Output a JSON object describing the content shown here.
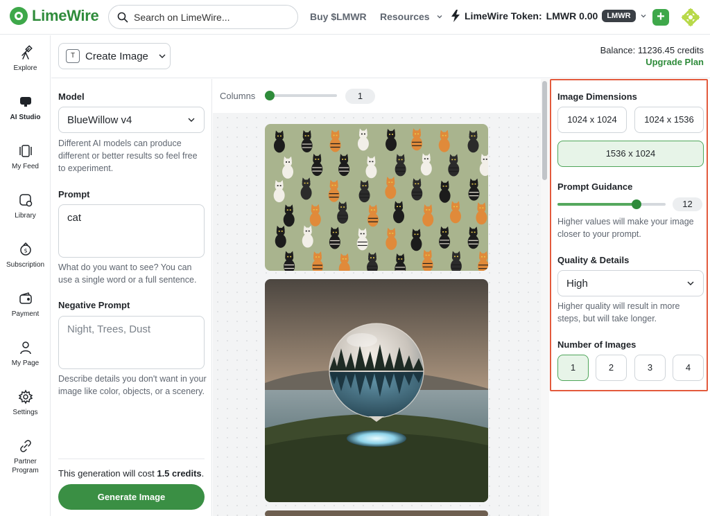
{
  "header": {
    "logo_text": "LimeWire",
    "search_placeholder": "Search on LimeWire...",
    "buy_label": "Buy $LMWR",
    "resources_label": "Resources",
    "token_label": "LimeWire Token:",
    "token_value": "LMWR 0.00",
    "token_badge": "LMWR",
    "plus_icon": "plus-icon",
    "avatar_icon": "avatar-icon"
  },
  "sidebar": {
    "items": [
      {
        "label": "Explore",
        "icon": "telescope-icon"
      },
      {
        "label": "AI Studio",
        "icon": "monitor-icon"
      },
      {
        "label": "My Feed",
        "icon": "feed-icon"
      },
      {
        "label": "Library",
        "icon": "library-icon"
      },
      {
        "label": "Subscription",
        "icon": "subscription-icon"
      },
      {
        "label": "Payment",
        "icon": "wallet-icon"
      },
      {
        "label": "My Page",
        "icon": "user-icon"
      },
      {
        "label": "Settings",
        "icon": "gear-icon"
      },
      {
        "label_line1": "Partner",
        "label_line2": "Program",
        "icon": "link-icon"
      }
    ]
  },
  "topbar": {
    "create_label": "Create Image",
    "balance": "Balance: 11236.45 credits",
    "upgrade": "Upgrade Plan"
  },
  "left": {
    "model_label": "Model",
    "model_value": "BlueWillow v4",
    "model_help": "Different AI models can produce different or better results so feel free to experiment.",
    "prompt_label": "Prompt",
    "prompt_value": "cat",
    "prompt_help": "What do you want to see? You can use a single word or a full sentence.",
    "negative_label": "Negative Prompt",
    "negative_placeholder": "Night, Trees, Dust",
    "negative_help": "Describe details you don't want in your image like color, objects, or a scenery.",
    "cost_prefix": "This generation will cost ",
    "cost_value": "1.5 credits",
    "cost_suffix": ".",
    "generate_label": "Generate Image"
  },
  "center": {
    "columns_label": "Columns",
    "columns_value": "1",
    "columns_fraction": 0.0
  },
  "right": {
    "dimensions_label": "Image Dimensions",
    "dimensions": [
      "1024 x 1024",
      "1024 x 1536",
      "1536 x 1024"
    ],
    "selected_dimension": "1536 x 1024",
    "guidance_label": "Prompt Guidance",
    "guidance_value": "12",
    "guidance_fraction": 0.75,
    "guidance_help": "Higher values will make your image closer to your prompt.",
    "quality_label": "Quality & Details",
    "quality_value": "High",
    "quality_help": "Higher quality will result in more steps, but will take longer.",
    "num_images_label": "Number of Images",
    "num_images": [
      "1",
      "2",
      "3",
      "4"
    ],
    "num_selected": "1"
  },
  "colors": {
    "brand_green": "#3ea84a",
    "button_green": "#3a8f44",
    "highlight_red": "#e35a3c"
  }
}
